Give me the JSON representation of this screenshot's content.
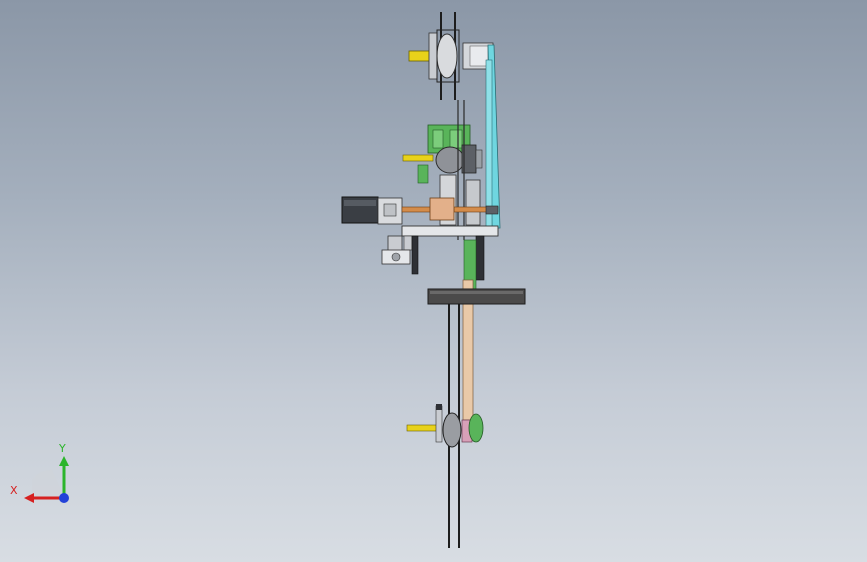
{
  "viewport": {
    "background_top": "#8b97a7",
    "background_bottom": "#d8dde3"
  },
  "triad": {
    "x_label": "X",
    "y_label": "Y",
    "x_color": "#d62020",
    "y_color": "#2bb52b",
    "z_color": "#2342d8"
  },
  "colors": {
    "shaft_yellow": "#e8d21a",
    "bracket_cyan": "#6fd6e0",
    "block_green": "#59b45a",
    "rod_orange": "#d48c4a",
    "motor_dark": "#3a3e44",
    "beam_dark": "#4b4a4a",
    "metal_grey": "#b8bcc2",
    "pink_part": "#d7a0b8"
  },
  "icons": [
    "triad-x-arrow-icon",
    "triad-y-arrow-icon",
    "triad-z-origin-icon"
  ]
}
